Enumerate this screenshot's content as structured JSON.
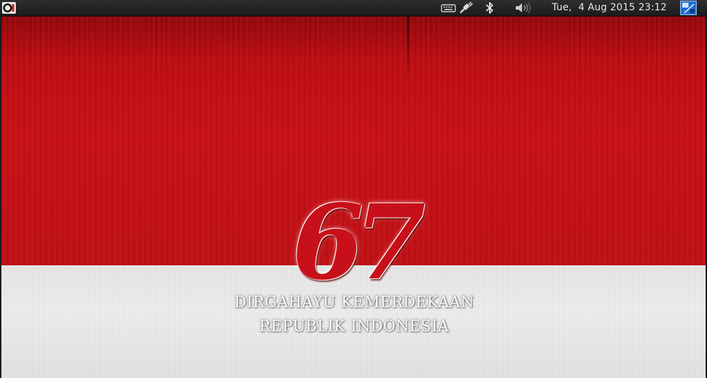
{
  "top_panel": {
    "activities_icon": "distro-logo-icon",
    "tray_icons": [
      "keyboard-icon",
      "network-cable-icon",
      "bluetooth-icon",
      "volume-icon"
    ],
    "clock": "Tue,  4 Aug 2015 23:12",
    "user_menu_icon": "user-menu-icon"
  },
  "wallpaper": {
    "number": "67",
    "line1": "DIRGAHAYU KEMERDEKAAN",
    "line2": "REPUBLIK INDONESIA",
    "colors": {
      "flag_red": "#c20f14",
      "flag_white": "#e8e8e8",
      "panel": "#1c1c1c"
    }
  }
}
